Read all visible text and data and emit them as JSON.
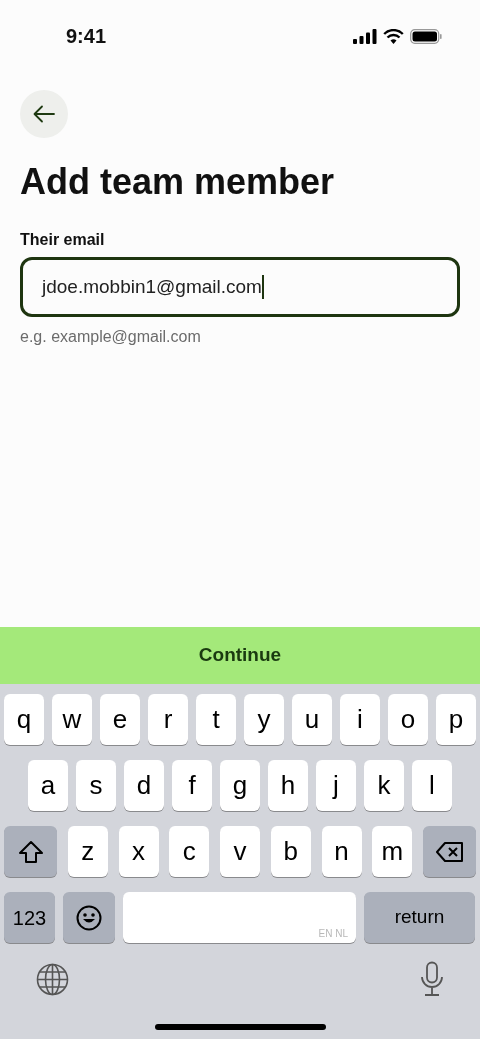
{
  "status_bar": {
    "time": "9:41"
  },
  "title": "Add team member",
  "email_field": {
    "label": "Their email",
    "value": "jdoe.mobbin1@gmail.com",
    "focused": true,
    "hint": "e.g. example@gmail.com"
  },
  "continue_button": {
    "label": "Continue"
  },
  "keyboard": {
    "rows": [
      {
        "keys": [
          {
            "kind": "letter",
            "label": "q"
          },
          {
            "kind": "letter",
            "label": "w"
          },
          {
            "kind": "letter",
            "label": "e"
          },
          {
            "kind": "letter",
            "label": "r"
          },
          {
            "kind": "letter",
            "label": "t"
          },
          {
            "kind": "letter",
            "label": "y"
          },
          {
            "kind": "letter",
            "label": "u"
          },
          {
            "kind": "letter",
            "label": "i"
          },
          {
            "kind": "letter",
            "label": "o"
          },
          {
            "kind": "letter",
            "label": "p"
          }
        ]
      },
      {
        "keys": [
          {
            "kind": "letter",
            "label": "a"
          },
          {
            "kind": "letter",
            "label": "s"
          },
          {
            "kind": "letter",
            "label": "d"
          },
          {
            "kind": "letter",
            "label": "f"
          },
          {
            "kind": "letter",
            "label": "g"
          },
          {
            "kind": "letter",
            "label": "h"
          },
          {
            "kind": "letter",
            "label": "j"
          },
          {
            "kind": "letter",
            "label": "k"
          },
          {
            "kind": "letter",
            "label": "l"
          }
        ]
      },
      {
        "keys": [
          {
            "kind": "shift"
          },
          {
            "kind": "letter",
            "label": "z"
          },
          {
            "kind": "letter",
            "label": "x"
          },
          {
            "kind": "letter",
            "label": "c"
          },
          {
            "kind": "letter",
            "label": "v"
          },
          {
            "kind": "letter",
            "label": "b"
          },
          {
            "kind": "letter",
            "label": "n"
          },
          {
            "kind": "letter",
            "label": "m"
          },
          {
            "kind": "delete"
          }
        ]
      },
      {
        "keys": [
          {
            "kind": "numbers",
            "label": "123"
          },
          {
            "kind": "emoji"
          },
          {
            "kind": "space",
            "label": "EN NL"
          },
          {
            "kind": "return",
            "label": "return"
          }
        ]
      }
    ]
  }
}
